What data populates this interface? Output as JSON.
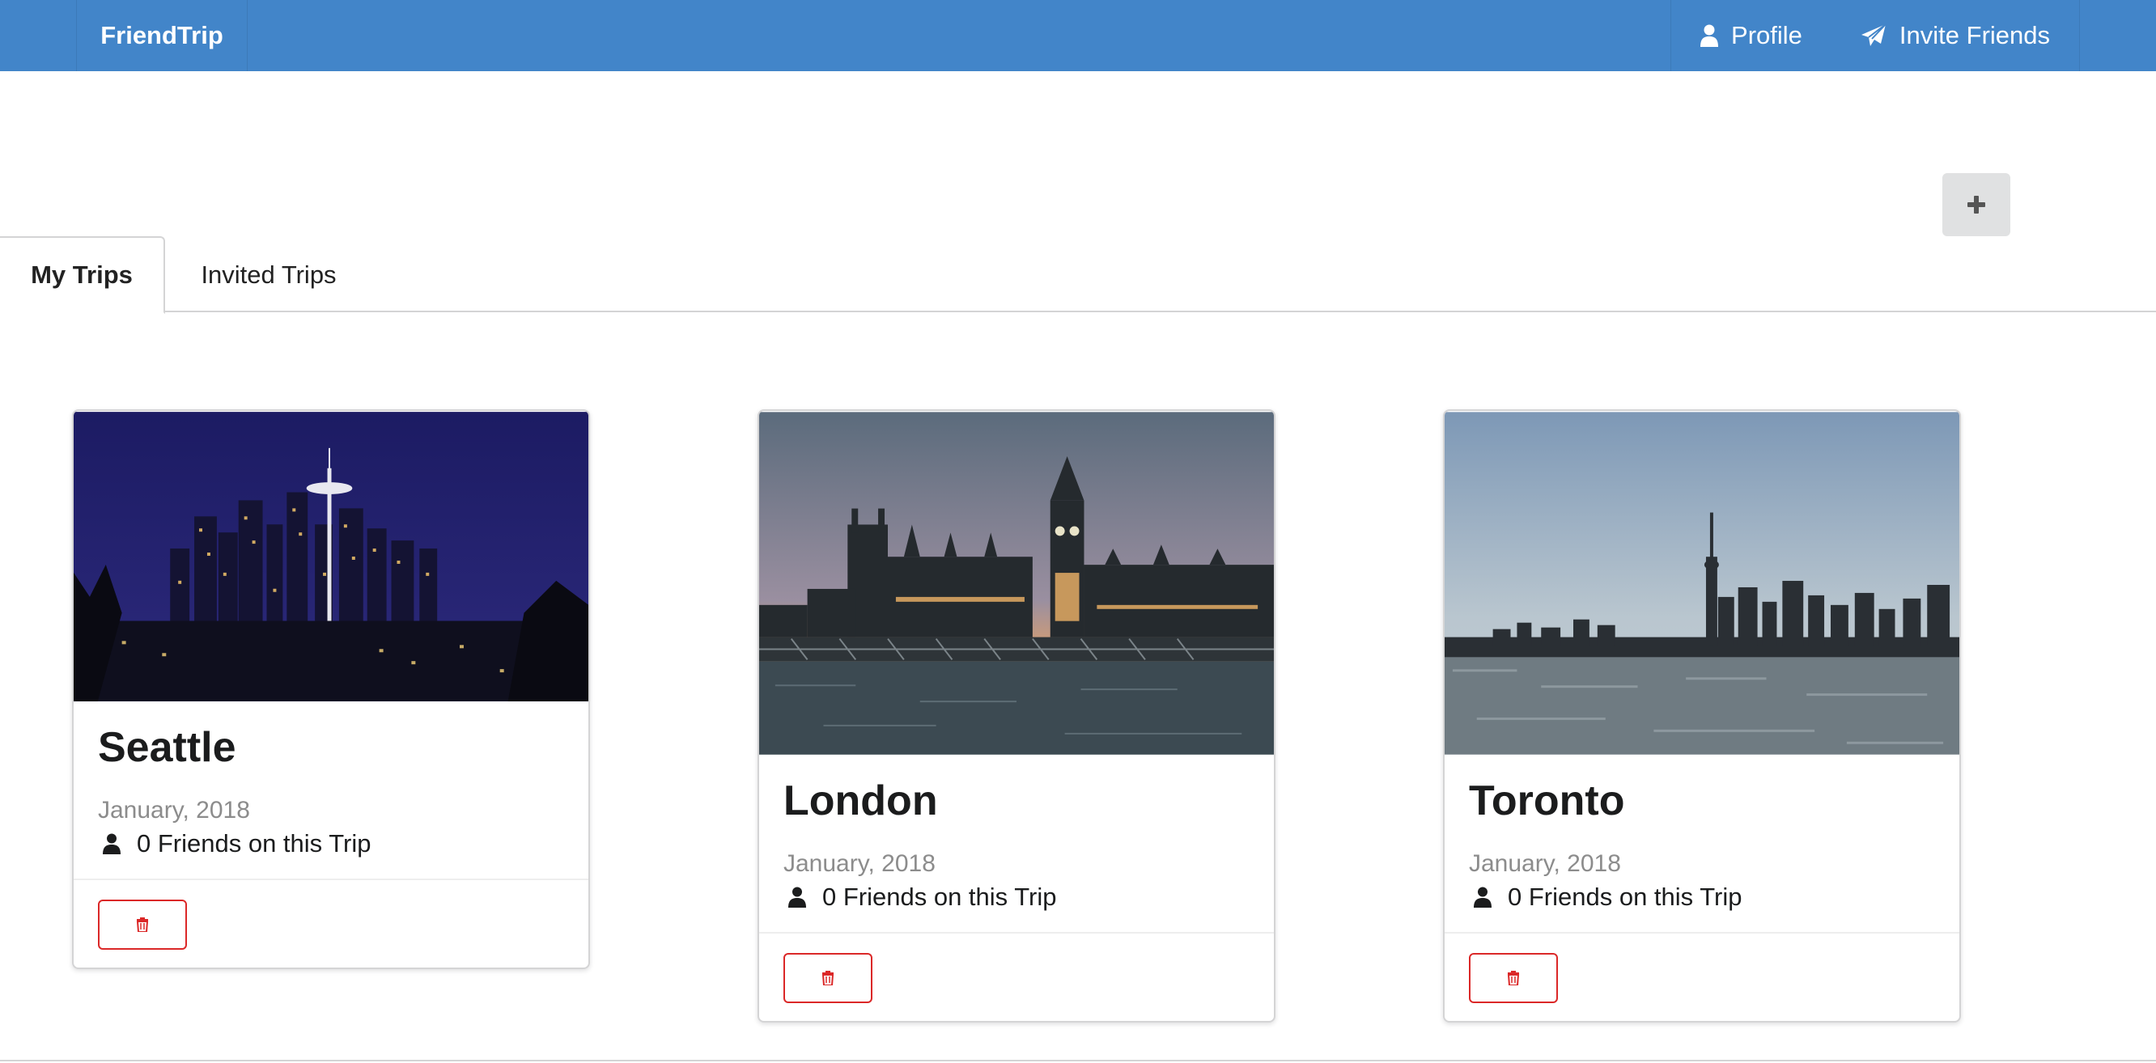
{
  "navbar": {
    "brand": "FriendTrip",
    "profile_label": "Profile",
    "invite_label": "Invite Friends"
  },
  "tabs": [
    {
      "label": "My Trips",
      "active": true
    },
    {
      "label": "Invited Trips",
      "active": false
    }
  ],
  "add_button": {
    "icon": "plus-icon"
  },
  "trips": [
    {
      "name": "Seattle",
      "date": "January, 2018",
      "friends": "0 Friends on this Trip"
    },
    {
      "name": "London",
      "date": "January, 2018",
      "friends": "0 Friends on this Trip"
    },
    {
      "name": "Toronto",
      "date": "January, 2018",
      "friends": "0 Friends on this Trip"
    }
  ],
  "colors": {
    "navbar": "#4285c9",
    "delete": "#db2828",
    "add_button": "#e0e1e2"
  }
}
